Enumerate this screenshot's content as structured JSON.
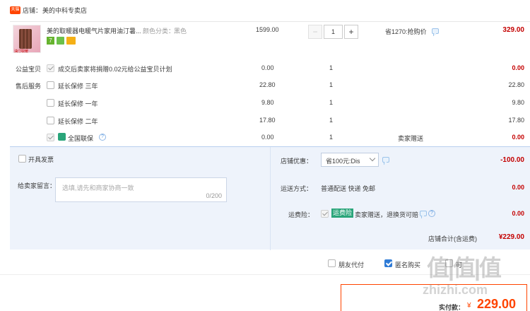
{
  "shop": {
    "badge": "天猫",
    "label": "店铺：",
    "name": "美的中科专卖店"
  },
  "item": {
    "title": "美的取暖器电暖气片家用油汀暑...",
    "spec_label": "颜色分类：",
    "spec_value": "黑色",
    "thumb_text": "油汀取暖",
    "price": "1599.00",
    "qty": "1",
    "minus": "−",
    "plus": "+",
    "promo": "省1270:抢购价",
    "subtotal": "329.00",
    "badge_7": "7"
  },
  "charity": {
    "label": "公益宝贝",
    "text": "成交后卖家将捐赠0.02元给公益宝贝计划",
    "price": "0.00",
    "qty": "1",
    "total": "0.00"
  },
  "service": {
    "label": "售后服务",
    "items": [
      {
        "text": "延长保修 三年",
        "price": "22.80",
        "qty": "1",
        "total": "22.80",
        "checked": false
      },
      {
        "text": "延长保修 一年",
        "price": "9.80",
        "qty": "1",
        "total": "9.80",
        "checked": false
      },
      {
        "text": "延长保修 二年",
        "price": "17.80",
        "qty": "1",
        "total": "17.80",
        "checked": false
      },
      {
        "text": "全国联保",
        "price": "0.00",
        "qty": "1",
        "note": "卖家赠送",
        "total": "0.00",
        "checked": true
      }
    ],
    "q": "?"
  },
  "invoice": {
    "label": "开具发票"
  },
  "message": {
    "label": "给卖家留言：",
    "placeholder": "选填,请先和商家协商一致",
    "counter": "0/200"
  },
  "discount": {
    "label": "店铺优惠：",
    "select": "省100元:Dis",
    "value": "-100.00"
  },
  "shipping": {
    "label": "运送方式：",
    "text": "普通配送 快递 免邮",
    "value": "0.00"
  },
  "insurance": {
    "label": "运费险：",
    "tag": "运费险",
    "text": "卖家赠送，退换货可赔",
    "value": "0.00",
    "q": "?"
  },
  "shop_total": {
    "label": "店铺合计(含运费)",
    "value": "¥229.00"
  },
  "footer": {
    "friend_pay": "朋友代付",
    "anonymous": "匿名购买",
    "partial": "可",
    "pay_label": "实付款：",
    "currency": "¥",
    "pay_value": "229.00"
  },
  "watermark": {
    "main": "值|值|值",
    "sub": "zhizhi.com"
  }
}
